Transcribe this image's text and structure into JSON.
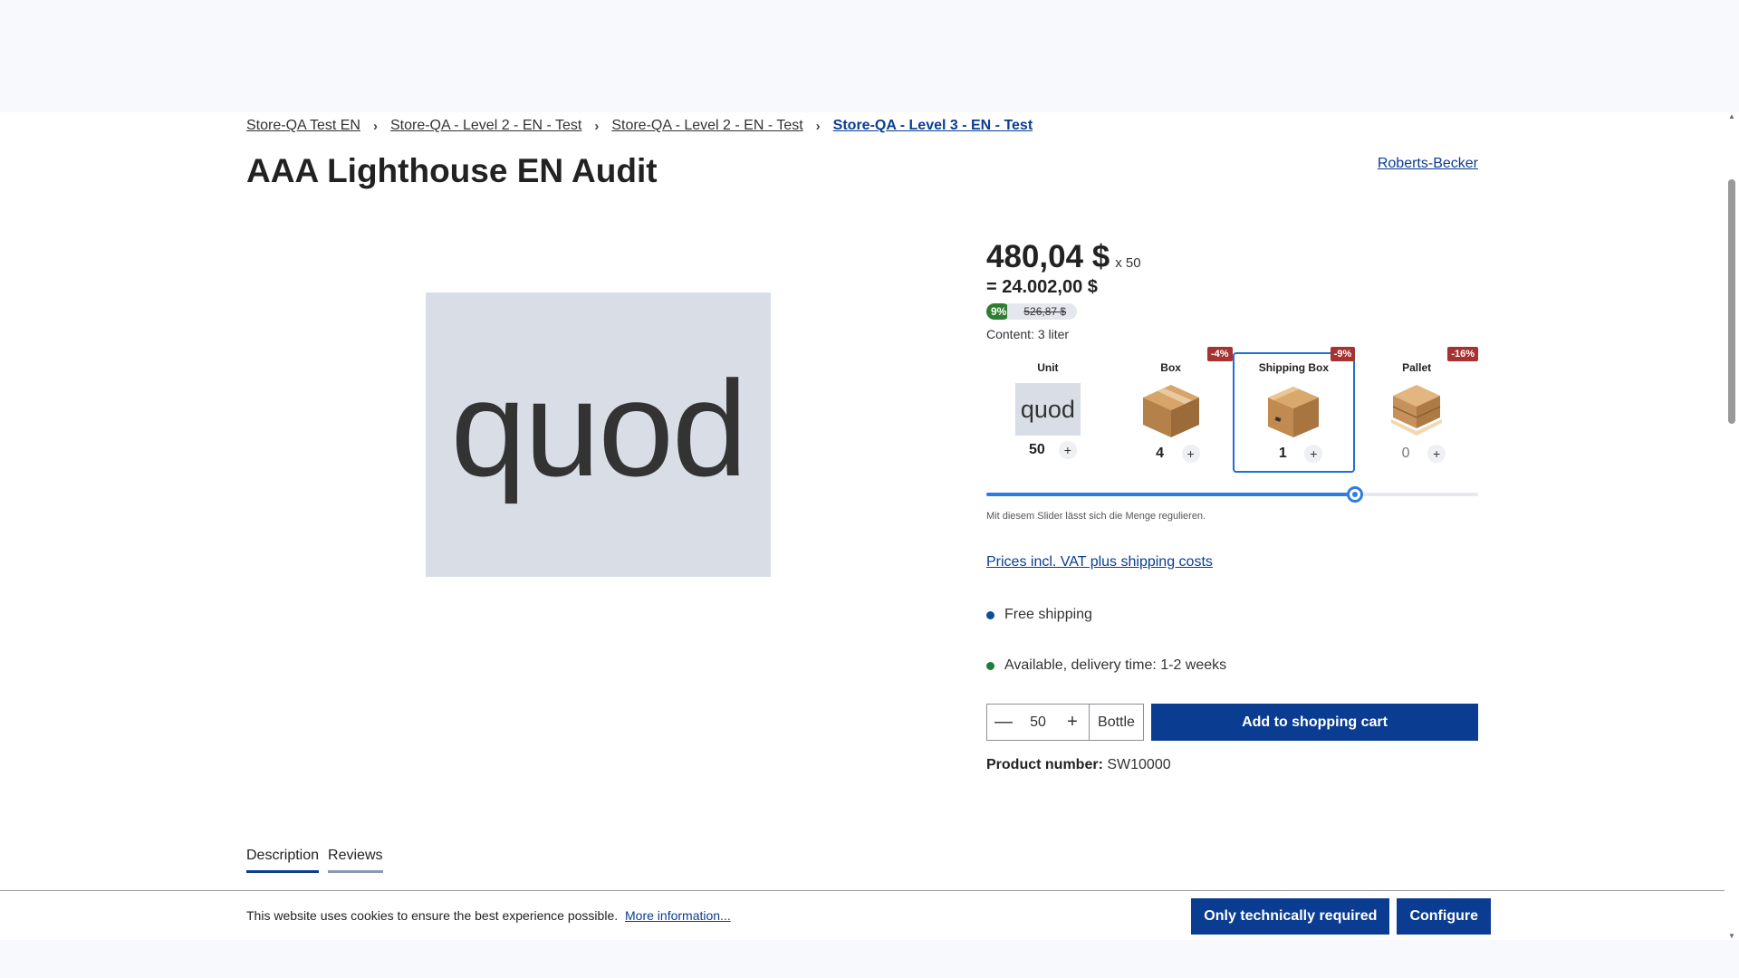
{
  "breadcrumb": {
    "items": [
      "Store-QA Test EN",
      "Store-QA - Level 2 - EN - Test",
      "Store-QA - Level 2 - EN - Test",
      "Store-QA - Level 3 - EN - Test"
    ],
    "separator": "›"
  },
  "product": {
    "title": "AAA Lighthouse EN Audit",
    "manufacturer": "Roberts-Becker",
    "image_text": "quod",
    "price": "480,04 $",
    "multiplier": "x 50",
    "total": "= 24.002,00 $",
    "discount_pct": "9%",
    "old_price": "526,87 $",
    "content": "Content: 3 liter",
    "number_label": "Product number:",
    "number": "SW10000"
  },
  "packs": [
    {
      "label": "Unit",
      "badge": "",
      "qty": "50",
      "image": "quod",
      "icon": "unit-placeholder-image"
    },
    {
      "label": "Box",
      "badge": "-4%",
      "qty": "4",
      "icon": "box-icon"
    },
    {
      "label": "Shipping Box",
      "badge": "-9%",
      "qty": "1",
      "icon": "shipping-box-icon",
      "active": true
    },
    {
      "label": "Pallet",
      "badge": "-16%",
      "qty": "0",
      "icon": "pallet-icon"
    }
  ],
  "pack_plus": "+",
  "slider": {
    "value_fraction": 0.75,
    "hint": "Mit diesem Slider lässt sich die Menge regulieren."
  },
  "vat_link": "Prices incl. VAT plus shipping costs",
  "shipping": "Free shipping",
  "availability": "Available, delivery time: 1-2 weeks",
  "cart": {
    "minus": "—",
    "quantity": "50",
    "plus": "+",
    "unit": "Bottle",
    "add_label": "Add to shopping cart"
  },
  "tabs": [
    "Description",
    "Reviews"
  ],
  "cookie": {
    "text": "This website uses cookies to ensure the best experience possible.",
    "link": "More information...",
    "btn_required": "Only technically required",
    "btn_configure": "Configure"
  },
  "colors": {
    "primary": "#0a3d91",
    "badge_red": "#a83232",
    "discount_green": "#2e7d32",
    "slider_blue": "#2f7be3"
  }
}
